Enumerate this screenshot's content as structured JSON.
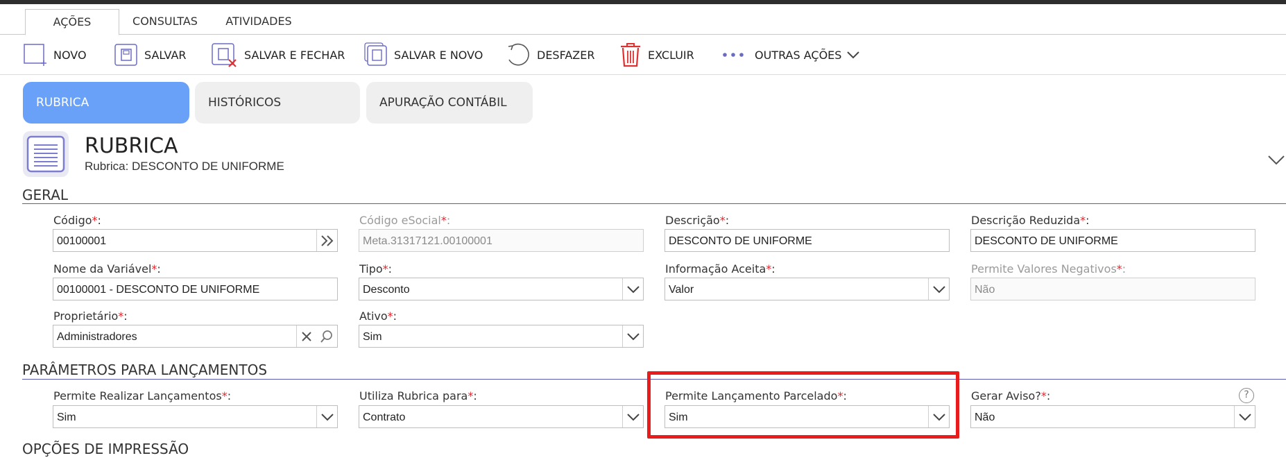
{
  "main_tabs": [
    {
      "label": "AÇÕES",
      "active": true
    },
    {
      "label": "CONSULTAS",
      "active": false
    },
    {
      "label": "ATIVIDADES",
      "active": false
    }
  ],
  "toolbar": {
    "new": "NOVO",
    "save": "SALVAR",
    "save_close": "SALVAR E FECHAR",
    "save_new": "SALVAR E NOVO",
    "undo": "DESFAZER",
    "delete": "EXCLUIR",
    "more": "OUTRAS AÇÕES"
  },
  "section_tabs": [
    {
      "label": "RUBRICA",
      "active": true
    },
    {
      "label": "HISTÓRICOS",
      "active": false
    },
    {
      "label": "APURAÇÃO CONTÁBIL",
      "active": false
    }
  ],
  "header": {
    "title": "RUBRICA",
    "subtitle": "Rubrica: DESCONTO DE UNIFORME"
  },
  "sections": {
    "geral": "GERAL",
    "parametros": "PARÂMETROS PARA LANÇAMENTOS",
    "impressao": "OPÇÕES DE IMPRESSÃO"
  },
  "required_mark": "*",
  "fields": {
    "codigo": {
      "label": "Código",
      "value": "00100001"
    },
    "codigo_esocial": {
      "label": "Código eSocial",
      "value": "Meta.31317121.00100001"
    },
    "descricao": {
      "label": "Descrição",
      "value": "DESCONTO DE UNIFORME"
    },
    "descricao_reduzida": {
      "label": "Descrição Reduzida",
      "value": "DESCONTO DE UNIFORME"
    },
    "nome_variavel": {
      "label": "Nome da Variável",
      "value": "00100001 - DESCONTO DE UNIFORME"
    },
    "tipo": {
      "label": "Tipo",
      "value": "Desconto"
    },
    "informacao_aceita": {
      "label": "Informação Aceita",
      "value": "Valor"
    },
    "permite_negativos": {
      "label": "Permite Valores Negativos",
      "value": "Não"
    },
    "proprietario": {
      "label": "Proprietário",
      "value": "Administradores"
    },
    "ativo": {
      "label": "Ativo",
      "value": "Sim"
    },
    "permite_lancamentos": {
      "label": "Permite Realizar Lançamentos",
      "value": "Sim"
    },
    "utiliza_rubrica": {
      "label": "Utiliza Rubrica para",
      "value": "Contrato"
    },
    "lancamento_parcelado": {
      "label": "Permite Lançamento Parcelado",
      "value": "Sim"
    },
    "gerar_aviso": {
      "label": "Gerar Aviso?",
      "value": "Não"
    }
  },
  "help_glyph": "?",
  "colors": {
    "accent_tab": "#6aa1f8",
    "required": "#e3242b",
    "highlight": "#e81c1c",
    "delete_icon": "#e03030"
  }
}
